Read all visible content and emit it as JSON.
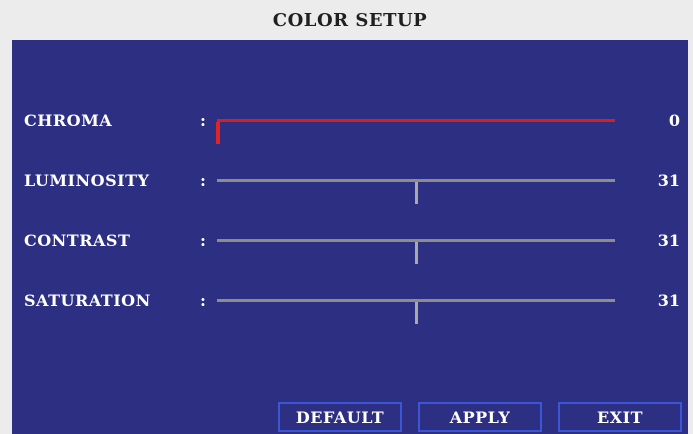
{
  "window": {
    "title": "COLOR SETUP"
  },
  "settings": [
    {
      "id": "chroma",
      "label": "CHROMA",
      "separator": ":",
      "value": "0",
      "level": 0,
      "active": true
    },
    {
      "id": "luminosity",
      "label": "LUMINOSITY",
      "separator": ":",
      "value": "31",
      "level": 0.5,
      "active": false
    },
    {
      "id": "contrast",
      "label": "CONTRAST",
      "separator": ":",
      "value": "31",
      "level": 0.5,
      "active": false
    },
    {
      "id": "saturation",
      "label": "SATURATION",
      "separator": ":",
      "value": "31",
      "level": 0.5,
      "active": false
    }
  ],
  "buttons": {
    "default_label": "DEFAULT",
    "apply_label": "APPLY",
    "exit_label": "EXIT"
  },
  "colors": {
    "panel_background": "#2c2f82",
    "title_background": "#ececec",
    "active_slider": "#d32020",
    "inactive_slider": "#8c8c8c",
    "button_border": "#3b56d6",
    "text": "#ffffff"
  }
}
